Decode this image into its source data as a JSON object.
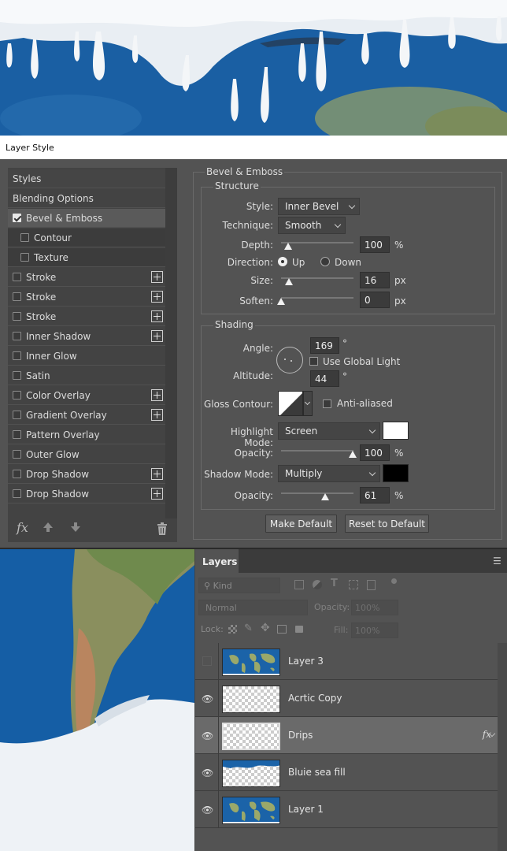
{
  "window_title": "Layer Style",
  "left_panel": {
    "items": [
      {
        "label": "Styles"
      },
      {
        "label": "Blending Options"
      },
      {
        "label": "Bevel & Emboss",
        "checked": true,
        "selected": true
      },
      {
        "label": "Contour",
        "checked": false,
        "sub": true
      },
      {
        "label": "Texture",
        "checked": false,
        "sub": true
      },
      {
        "label": "Stroke",
        "checked": false,
        "plus": true
      },
      {
        "label": "Stroke",
        "checked": false,
        "plus": true
      },
      {
        "label": "Stroke",
        "checked": false,
        "plus": true
      },
      {
        "label": "Inner Shadow",
        "checked": false,
        "plus": true
      },
      {
        "label": "Inner Glow",
        "checked": false
      },
      {
        "label": "Satin",
        "checked": false
      },
      {
        "label": "Color Overlay",
        "checked": false,
        "plus": true
      },
      {
        "label": "Gradient Overlay",
        "checked": false,
        "plus": true
      },
      {
        "label": "Pattern Overlay",
        "checked": false
      },
      {
        "label": "Outer Glow",
        "checked": false
      },
      {
        "label": "Drop Shadow",
        "checked": false,
        "plus": true
      },
      {
        "label": "Drop Shadow",
        "checked": false,
        "plus": true
      }
    ],
    "footer_fx": "fx"
  },
  "bevel": {
    "title": "Bevel & Emboss",
    "structure_title": "Structure",
    "style_label": "Style:",
    "style_value": "Inner Bevel",
    "technique_label": "Technique:",
    "technique_value": "Smooth",
    "depth_label": "Depth:",
    "depth_value": "100",
    "depth_unit": "%",
    "direction_label": "Direction:",
    "direction_up": "Up",
    "direction_down": "Down",
    "direction_selected": "Up",
    "size_label": "Size:",
    "size_value": "16",
    "size_unit": "px",
    "soften_label": "Soften:",
    "soften_value": "0",
    "soften_unit": "px"
  },
  "shading": {
    "title": "Shading",
    "angle_label": "Angle:",
    "angle_value": "169",
    "angle_unit": "°",
    "use_global_light": "Use Global Light",
    "use_global_light_checked": false,
    "altitude_label": "Altitude:",
    "altitude_value": "44",
    "altitude_unit": "°",
    "gloss_contour_label": "Gloss Contour:",
    "anti_aliased": "Anti-aliased",
    "anti_aliased_checked": false,
    "highlight_mode_label": "Highlight Mode:",
    "highlight_mode_value": "Screen",
    "highlight_color": "#ffffff",
    "highlight_opacity_label": "Opacity:",
    "highlight_opacity_value": "100",
    "highlight_opacity_unit": "%",
    "shadow_mode_label": "Shadow Mode:",
    "shadow_mode_value": "Multiply",
    "shadow_color": "#000000",
    "shadow_opacity_label": "Opacity:",
    "shadow_opacity_value": "61",
    "shadow_opacity_unit": "%"
  },
  "buttons": {
    "make_default": "Make Default",
    "reset_default": "Reset to Default"
  },
  "layers_panel": {
    "tab": "Layers",
    "kind_label": "Kind",
    "blend_mode": "Normal",
    "opacity_label": "Opacity:",
    "opacity_value": "100%",
    "lock_label": "Lock:",
    "fill_label": "Fill:",
    "fill_value": "100%",
    "layers": [
      {
        "name": "Layer 3",
        "visible": false,
        "thumb": "world"
      },
      {
        "name": "Acrtic Copy",
        "visible": true,
        "thumb": "checker"
      },
      {
        "name": "Drips",
        "visible": true,
        "thumb": "checker",
        "selected": true,
        "fx": "fx"
      },
      {
        "name": "Bluie sea fill",
        "visible": true,
        "thumb": "checker-blue"
      },
      {
        "name": "Layer 1",
        "visible": true,
        "thumb": "world"
      }
    ]
  }
}
